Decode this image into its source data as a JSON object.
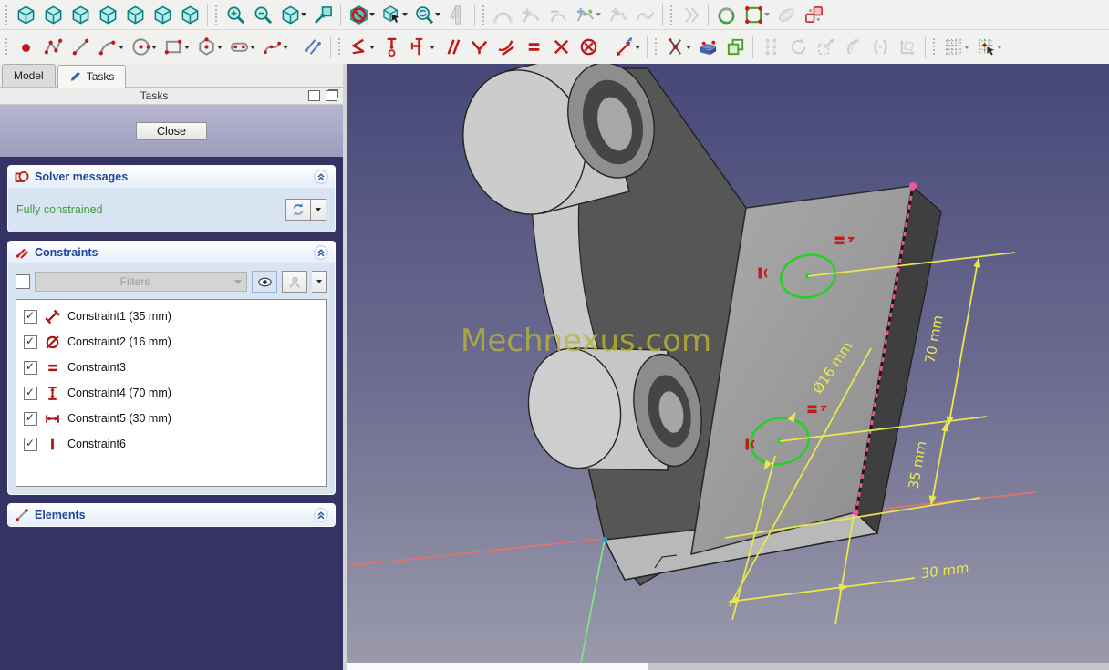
{
  "toolbars": {
    "row1_icons": [
      "axonometric-view-icon",
      "front-view-icon",
      "top-view-icon",
      "right-view-icon",
      "rear-view-icon",
      "bottom-view-icon",
      "left-view-icon",
      "zoom-in-icon",
      "zoom-out-icon",
      "fit-all-icon",
      "fit-selection-icon",
      "clip-plane-icon",
      "box-selection-icon",
      "zoom-refresh-icon",
      "measure-icon",
      "bspline-information-icon",
      "bspline-increase-degree-icon",
      "bspline-decrease-degree-icon",
      "bspline-knot-multiplicity-icon",
      "bspline-insert-knot-icon",
      "bspline-join-curves-icon",
      "split-edge-icon",
      "create-periodic-bspline-icon",
      "create-polygon-icon",
      "create-ellipse-icon",
      "copy-sketch-geometry-icon"
    ],
    "row2_icons": [
      "create-point-icon",
      "create-polyline-icon",
      "create-line-icon",
      "create-arc-icon",
      "create-circle-icon",
      "create-rectangle-icon",
      "create-hexagon-icon",
      "create-slot-icon",
      "create-bspline-icon",
      "toggle-construction-icon",
      "constrain-coincident-icon",
      "constrain-point-on-object-icon",
      "constrain-distance-axes-icon",
      "constrain-parallel-icon",
      "constrain-perpendicular-icon",
      "constrain-tangent-icon",
      "constrain-equal-icon",
      "constrain-symmetric-icon",
      "constrain-block-icon",
      "constrain-dimension-icon",
      "constrain-lock-icon",
      "toggle-driving-constraint-icon",
      "clone-icon",
      "select-conflicting-icon",
      "rotate-icon",
      "scale-icon",
      "offset-icon",
      "symmetry-icon",
      "move-icon",
      "toggle-grid-icon",
      "toggle-snap-icon"
    ]
  },
  "left_panel": {
    "tabs": {
      "model": "Model",
      "tasks": "Tasks"
    },
    "panel_title": "Tasks",
    "close_label": "Close",
    "solver": {
      "title": "Solver messages",
      "message": "Fully constrained",
      "message_color": "#3f9b40"
    },
    "constraints": {
      "title": "Constraints",
      "filters_label": "Filters",
      "items": [
        {
          "label": "Constraint1 (35 mm)",
          "icon": "distance-constraint-icon",
          "checked": true
        },
        {
          "label": "Constraint2 (16 mm)",
          "icon": "diameter-constraint-icon",
          "checked": true
        },
        {
          "label": "Constraint3",
          "icon": "equal-constraint-icon",
          "checked": true
        },
        {
          "label": "Constraint4 (70 mm)",
          "icon": "vertical-distance-constraint-icon",
          "checked": true
        },
        {
          "label": "Constraint5 (30 mm)",
          "icon": "horizontal-distance-constraint-icon",
          "checked": true
        },
        {
          "label": "Constraint6",
          "icon": "vertical-constraint-icon",
          "checked": true
        }
      ]
    },
    "elements": {
      "title": "Elements"
    }
  },
  "viewport": {
    "watermark": "Mechnexus.com",
    "dim_70": "70 mm",
    "dim_35": "35 mm",
    "dim_30": "30 mm",
    "dim_dia": "Ø16 mm",
    "colors": {
      "background_top": "#474778",
      "background_bottom": "#9a9aab",
      "dimension_yellow": "#eae64e",
      "sketch_highlight_green": "#1ed31e",
      "x_axis_red": "#e0736b",
      "y_axis_green": "#7de87f",
      "selected_edge_pink": "#f0559e",
      "constraint_mark_red": "#c41c1c"
    }
  }
}
